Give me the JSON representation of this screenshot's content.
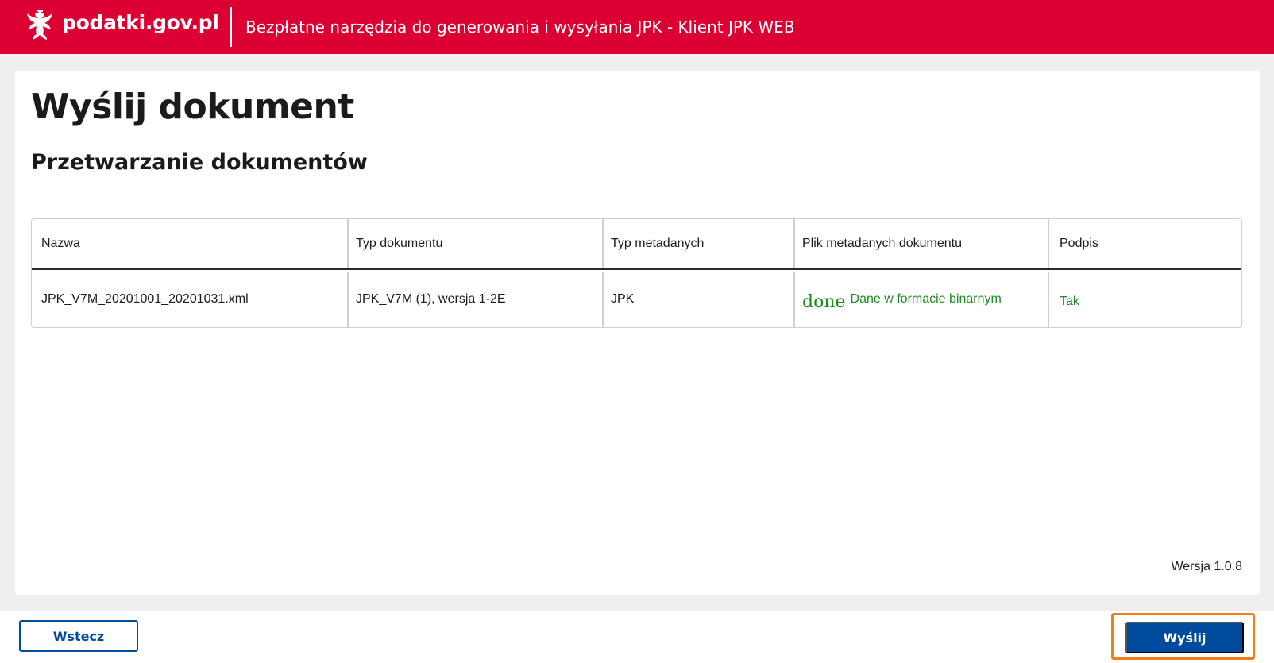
{
  "header": {
    "logo_text": "podatki.gov.pl",
    "title": "Bezpłatne narzędzia do generowania i wysyłania JPK - Klient JPK WEB",
    "background_color": "#dc0032"
  },
  "main": {
    "page_title": "Wyślij dokument",
    "section_title": "Przetwarzanie dokumentów",
    "table": {
      "columns": [
        "Nazwa",
        "Typ dokumentu",
        "Typ metadanych",
        "Plik metadanych dokumentu",
        "Podpis"
      ],
      "rows": [
        {
          "nazwa": "JPK_V7M_20201001_20201031.xml",
          "typ_dokumentu": "JPK_V7M (1), wersja 1-2E",
          "typ_metadanych": "JPK",
          "plik_icon": "done",
          "plik_text": "Dane w formacie binarnym",
          "podpis": "Tak"
        }
      ]
    },
    "version": "Wersja 1.0.8"
  },
  "footer": {
    "back_label": "Wstecz",
    "send_label": "Wyślij",
    "accent_color": "#004b9e",
    "highlight_color": "#f07d1b"
  },
  "icons": {
    "logo": "white-eagle-emblem-icon",
    "status": "done-check-icon"
  }
}
